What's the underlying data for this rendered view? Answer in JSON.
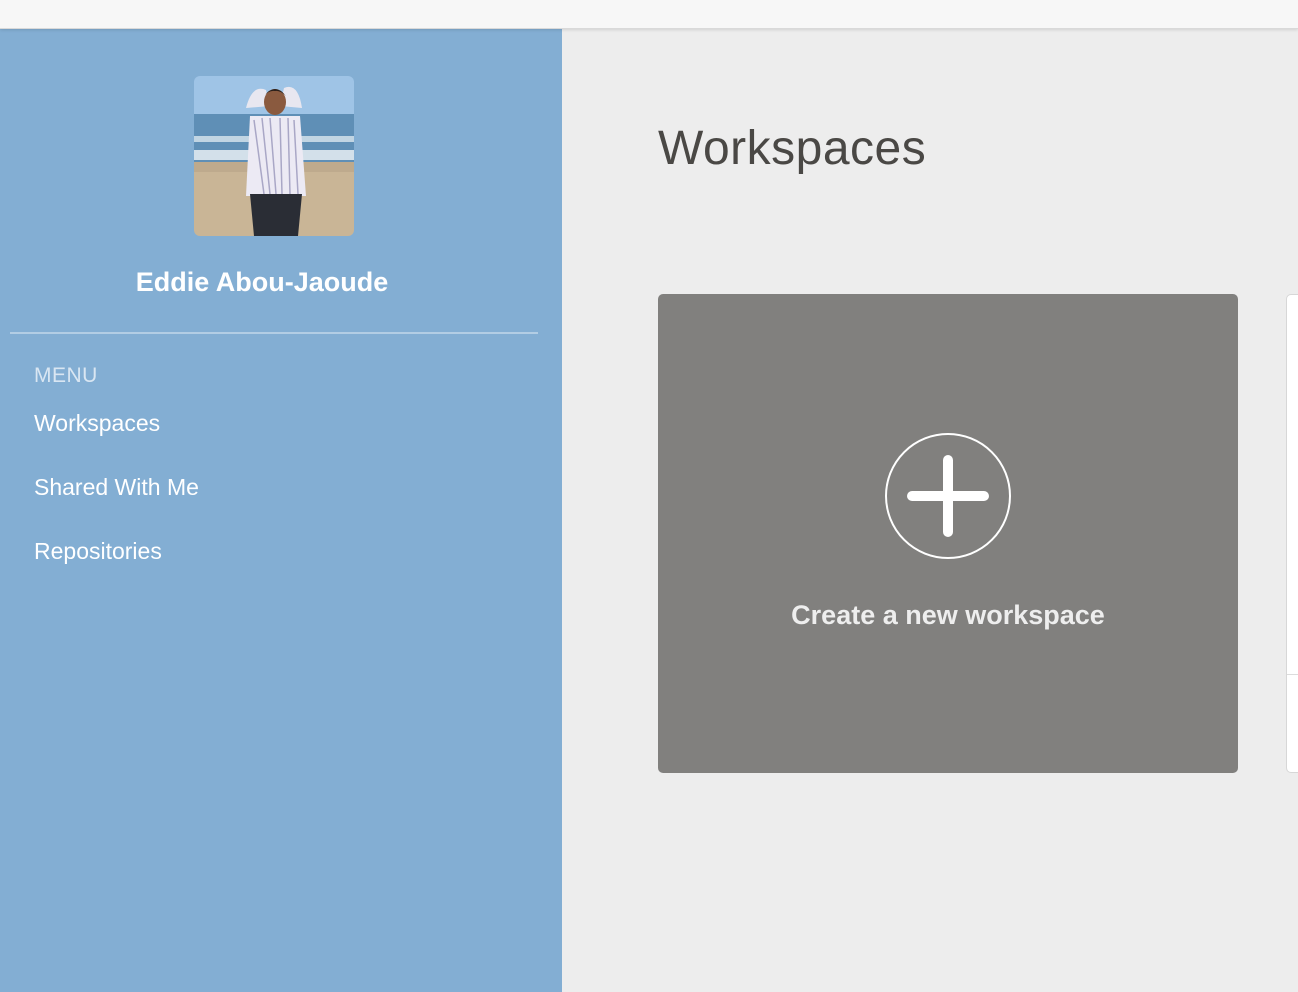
{
  "user": {
    "name": "Eddie Abou-Jaoude"
  },
  "sidebar": {
    "menu_heading": "MENU",
    "items": [
      {
        "label": "Workspaces"
      },
      {
        "label": "Shared With Me"
      },
      {
        "label": "Repositories"
      }
    ]
  },
  "main": {
    "title": "Workspaces",
    "create_card": {
      "label": "Create a new workspace",
      "icon": "plus-circle-icon"
    }
  },
  "colors": {
    "sidebar_bg": "#83aed3",
    "main_bg": "#ededed",
    "card_bg": "#81807e"
  }
}
